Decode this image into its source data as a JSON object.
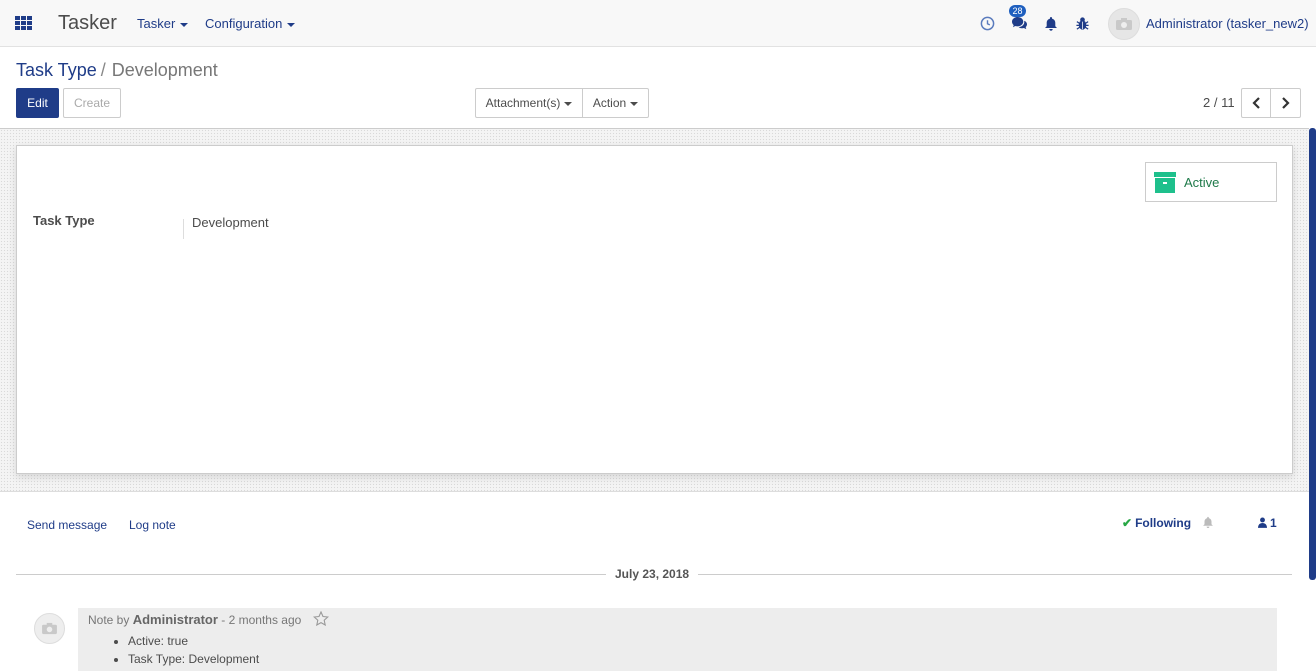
{
  "navbar": {
    "brand": "Tasker",
    "menus": [
      {
        "label": "Tasker"
      },
      {
        "label": "Configuration"
      }
    ],
    "messages_badge": "28",
    "user": "Administrator (tasker_new2)"
  },
  "breadcrumb": {
    "parent": "Task Type",
    "separator": "/",
    "current": "Development"
  },
  "buttons": {
    "edit": "Edit",
    "create": "Create",
    "attachments": "Attachment(s)",
    "action": "Action"
  },
  "pager": {
    "value": "2 / 11"
  },
  "form": {
    "active_label": "Active",
    "field_label": "Task Type",
    "field_value": "Development"
  },
  "chatter": {
    "send_message": "Send message",
    "log_note": "Log note",
    "following": "Following",
    "followers_count": "1",
    "date": "July 23, 2018",
    "message": {
      "prefix": "Note by",
      "author": "Administrator",
      "time": "- 2 months ago",
      "changes": [
        "Active: true",
        "Task Type: Development"
      ]
    }
  },
  "colors": {
    "primary": "#1f3c88",
    "active_green": "#1ec08c",
    "following_check": "#28a745"
  },
  "icons": [
    "apps-grid-icon",
    "clock-icon",
    "chat-icon",
    "bell-icon",
    "bug-icon",
    "camera-avatar-icon",
    "chevron-left-icon",
    "chevron-right-icon",
    "archive-icon",
    "check-icon",
    "user-icon",
    "star-icon"
  ]
}
